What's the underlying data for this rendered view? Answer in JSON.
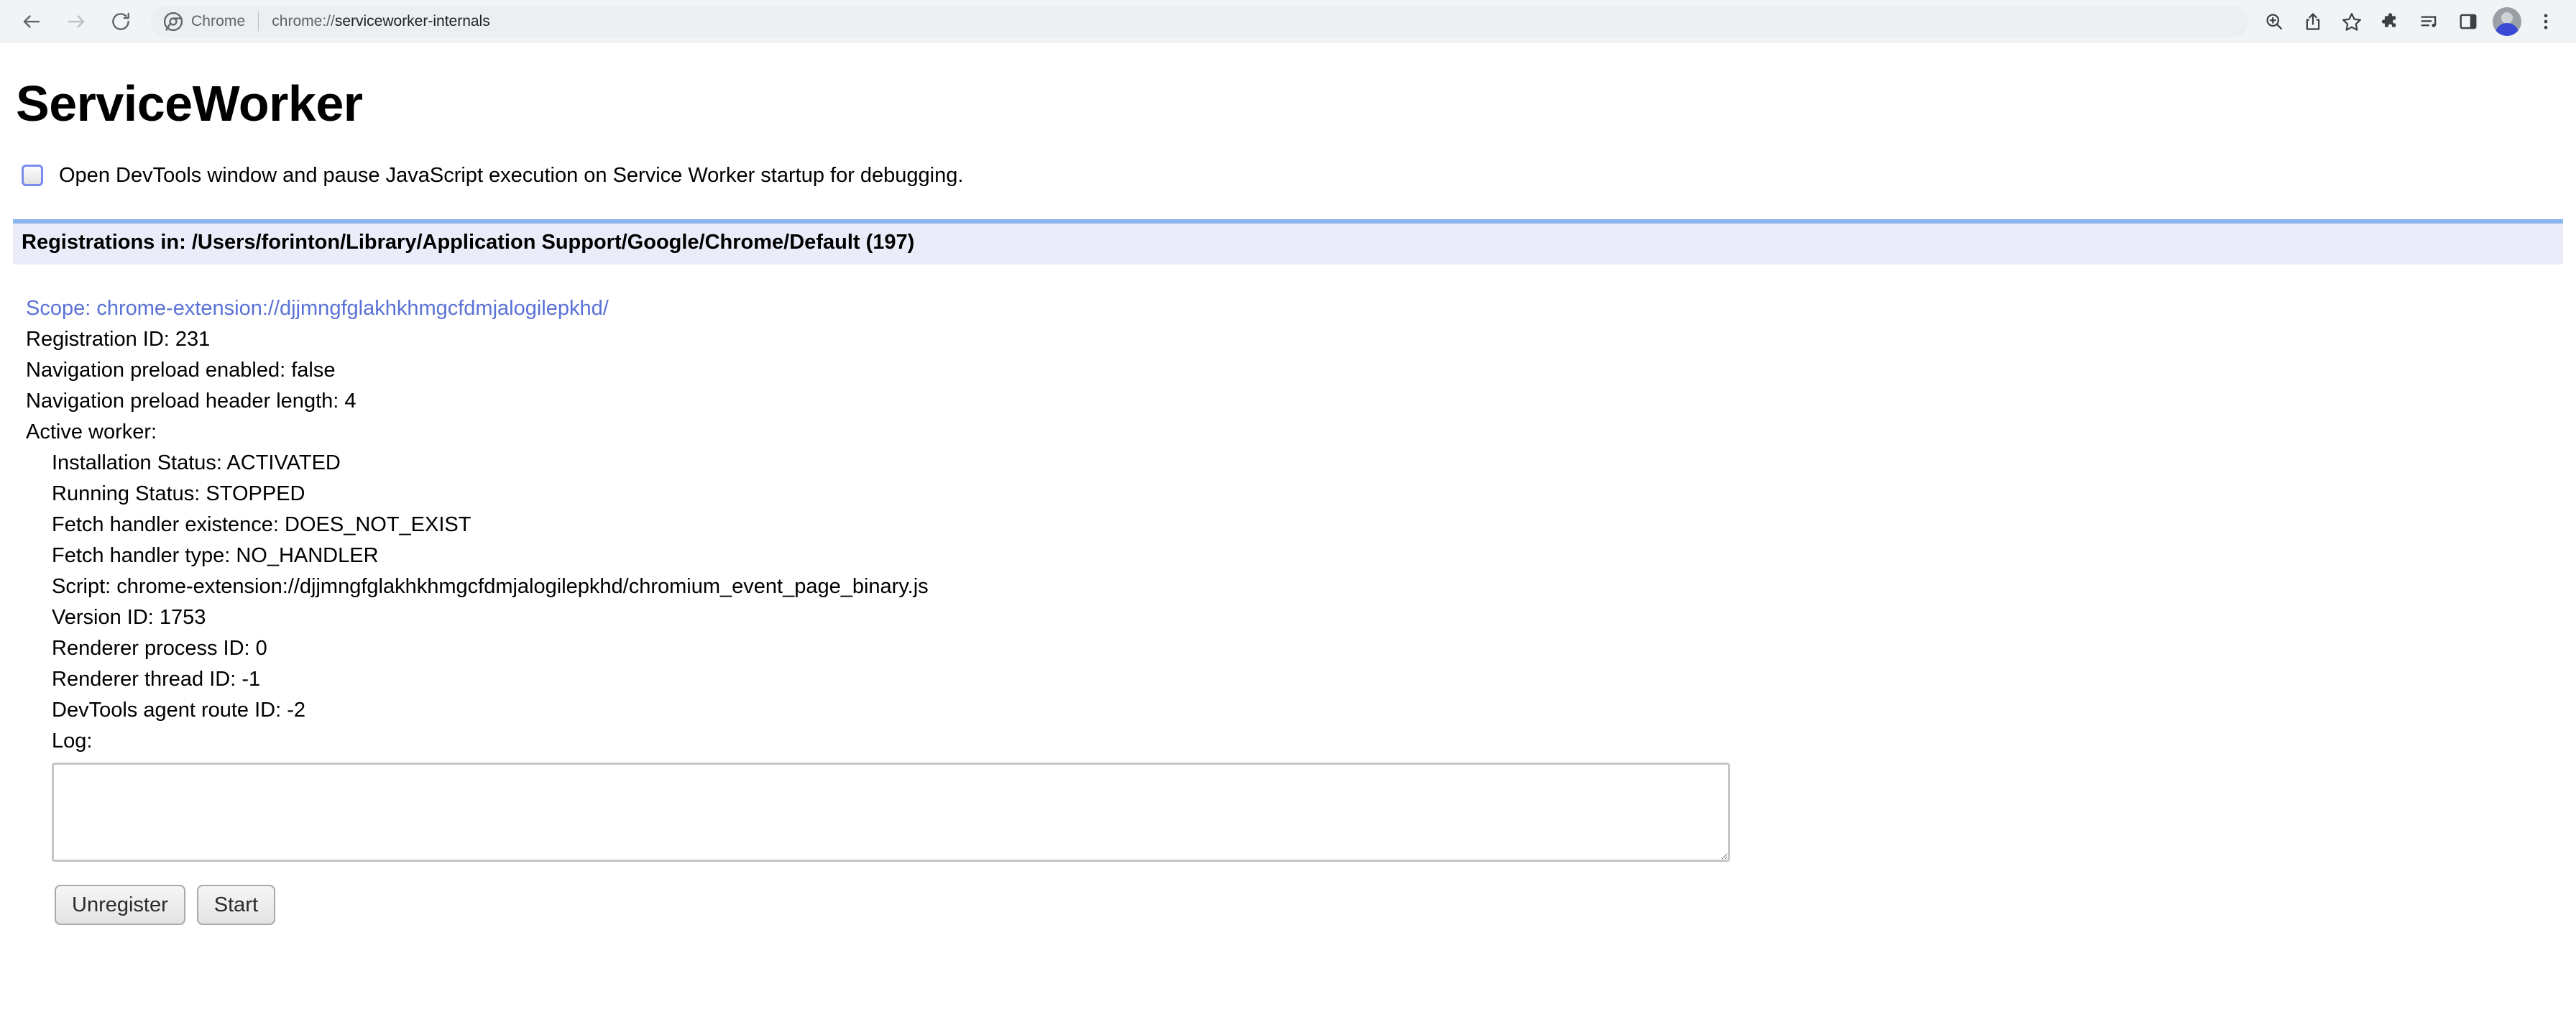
{
  "browser": {
    "nav": {
      "back_icon": "arrow-left-icon",
      "forward_icon": "arrow-right-icon",
      "reload_icon": "reload-icon"
    },
    "omnibox": {
      "chip_label": "Chrome",
      "url_scheme": "chrome://",
      "url_rest": "serviceworker-internals",
      "full_url": "chrome://serviceworker-internals",
      "logo_icon": "chrome-logo-icon"
    },
    "actions": [
      {
        "name": "zoom-in-icon",
        "label": "Zoom"
      },
      {
        "name": "share-icon",
        "label": "Share"
      },
      {
        "name": "bookmark-star-icon",
        "label": "Bookmark this tab"
      },
      {
        "name": "extensions-puzzle-icon",
        "label": "Extensions"
      },
      {
        "name": "media-playlist-icon",
        "label": "Media controls"
      },
      {
        "name": "side-panel-icon",
        "label": "Side panel"
      },
      {
        "name": "avatar-icon",
        "label": "Profile"
      },
      {
        "name": "three-dot-menu-icon",
        "label": "Customize and control Google Chrome"
      }
    ]
  },
  "page": {
    "title": "ServiceWorker",
    "devtools_option": {
      "checked": false,
      "label": "Open DevTools window and pause JavaScript execution on Service Worker startup for debugging."
    },
    "registrations_header": "Registrations in: /Users/forinton/Library/Application Support/Google/Chrome/Default (197)",
    "registration": {
      "scope": "Scope: chrome-extension://djjmngfglakhkhmgcfdmjalogilepkhd/",
      "registration_id": "Registration ID: 231",
      "navigation_preload_enabled": "Navigation preload enabled: false",
      "navigation_preload_header_length": "Navigation preload header length: 4",
      "active_worker_label": "Active worker:",
      "installation_status": "Installation Status: ACTIVATED",
      "running_status": "Running Status: STOPPED",
      "fetch_handler_existence": "Fetch handler existence: DOES_NOT_EXIST",
      "fetch_handler_type": "Fetch handler type: NO_HANDLER",
      "script": "Script: chrome-extension://djjmngfglakhkhmgcfdmjalogilepkhd/chromium_event_page_binary.js",
      "version_id": "Version ID: 1753",
      "renderer_process_id": "Renderer process ID: 0",
      "renderer_thread_id": "Renderer thread ID: -1",
      "devtools_agent_route_id": "DevTools agent route ID: -2",
      "log_label": "Log:",
      "log_value": "",
      "unregister_label": "Unregister",
      "start_label": "Start"
    }
  },
  "colors": {
    "toolbar_bg": "#f1f3f4",
    "omnibox_bg": "#eceff1",
    "header_bg": "#eaedf9",
    "header_border": "#8cb4ec",
    "link": "#5a72d6",
    "checkbox_border": "#7a8bf0",
    "text": "#000000"
  }
}
